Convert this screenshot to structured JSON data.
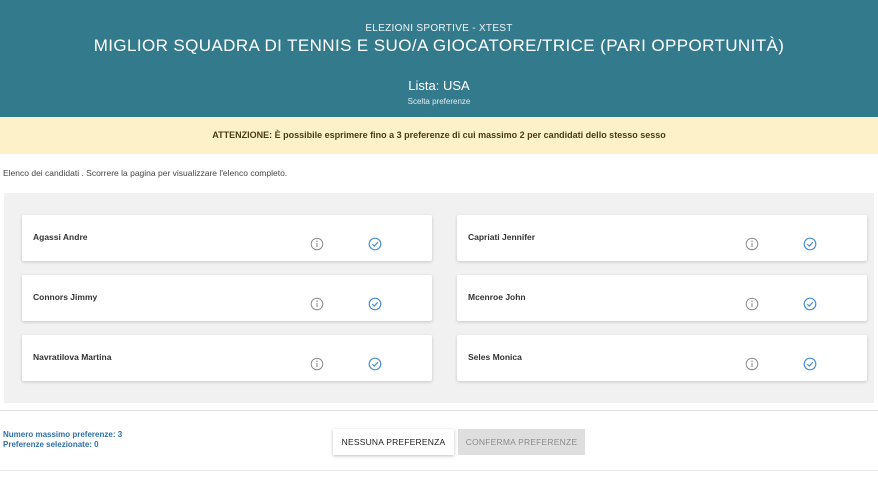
{
  "header": {
    "suptitle": "ELEZIONI SPORTIVE - XTEST",
    "title": "MIGLIOR SQUADRA DI TENNIS E SUO/A GIOCATORE/TRICE (PARI OPPORTUNITÀ)",
    "lista": "Lista: USA",
    "subtitle": "Scelta preferenze"
  },
  "notice": "ATTENZIONE: È possibile esprimere fino a 3 preferenze di cui massimo 2 per candidati dello stesso sesso",
  "intro": "Elenco dei candidati . Scorrere la pagina per visualizzare l'elenco completo.",
  "candidates": [
    {
      "name": "Agassi Andre",
      "info_icon": "info-icon",
      "select_icon": "check-circle-icon"
    },
    {
      "name": "Capriati Jennifer",
      "info_icon": "info-icon",
      "select_icon": "check-circle-icon"
    },
    {
      "name": "Connors Jimmy",
      "info_icon": "info-icon",
      "select_icon": "check-circle-icon"
    },
    {
      "name": "Mcenroe John",
      "info_icon": "info-icon",
      "select_icon": "check-circle-icon"
    },
    {
      "name": "Navratilova Martina",
      "info_icon": "info-icon",
      "select_icon": "check-circle-icon"
    },
    {
      "name": "Seles Monica",
      "info_icon": "info-icon",
      "select_icon": "check-circle-icon"
    }
  ],
  "footer": {
    "max_label": "Numero massimo preferenze: 3",
    "selected_label": "Preferenze selezionate: 0",
    "none_button": "NESSUNA PREFERENZA",
    "confirm_button": "CONFERMA PREFERENZE"
  },
  "colors": {
    "header_bg": "#347a8d",
    "notice_bg": "#fdf1c9",
    "accent_blue": "#2f6fa8",
    "check_color": "#4a8fd6"
  }
}
